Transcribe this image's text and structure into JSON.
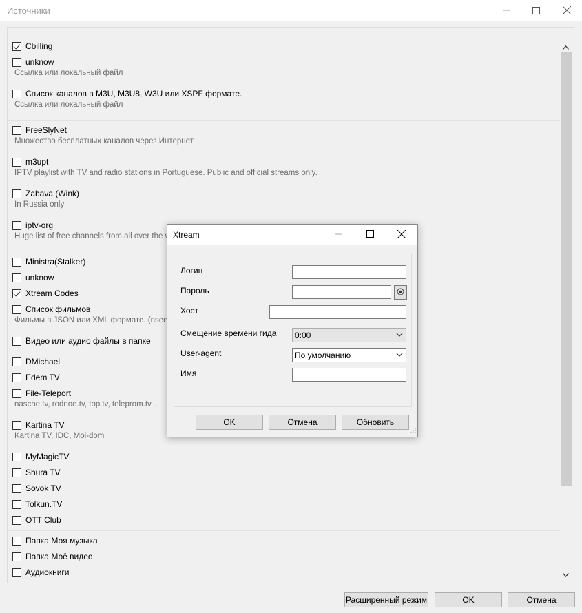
{
  "window": {
    "title": "Источники"
  },
  "sources": [
    {
      "label": "Cbilling",
      "checked": true,
      "desc": ""
    },
    {
      "label": "unknow",
      "checked": false,
      "desc": "Ссылка или локальный файл"
    },
    {
      "label": "Список каналов в M3U, M3U8, W3U или XSPF формате.",
      "checked": false,
      "desc": "Ссылка или локальный файл"
    },
    {
      "label": "FreeSlyNet",
      "checked": false,
      "desc": "Множество бесплатных каналов через Интернет"
    },
    {
      "label": "m3upt",
      "checked": false,
      "desc": "IPTV playlist with TV and radio stations in Portuguese. Public and official streams only."
    },
    {
      "label": "Zabava (Wink)",
      "checked": false,
      "desc": "In Russia only"
    },
    {
      "label": "iptv-org",
      "checked": false,
      "desc": "Huge list of free channels from all over the world"
    },
    {
      "label": "Ministra(Stalker)",
      "checked": false,
      "desc": ""
    },
    {
      "label": "unknow",
      "checked": false,
      "desc": ""
    },
    {
      "label": "Xtream Codes",
      "checked": true,
      "desc": ""
    },
    {
      "label": "Список фильмов",
      "checked": false,
      "desc": "Фильмы в JSON или XML формате. (nserv,.."
    },
    {
      "label": "Видео или аудио файлы в папке",
      "checked": false,
      "desc": ""
    },
    {
      "label": "DMichael",
      "checked": false,
      "desc": ""
    },
    {
      "label": "Edem TV",
      "checked": false,
      "desc": ""
    },
    {
      "label": "File-Teleport",
      "checked": false,
      "desc": "nasche.tv, rodnoe.tv, top.tv, teleprom.tv..."
    },
    {
      "label": "Kartina TV",
      "checked": false,
      "desc": "Kartina TV, IDC, Moi-dom"
    },
    {
      "label": "MyMagicTV",
      "checked": false,
      "desc": ""
    },
    {
      "label": "Shura TV",
      "checked": false,
      "desc": ""
    },
    {
      "label": "Sovok TV",
      "checked": false,
      "desc": ""
    },
    {
      "label": "Tolkun.TV",
      "checked": false,
      "desc": ""
    },
    {
      "label": "OTT Club",
      "checked": false,
      "desc": ""
    },
    {
      "label": "Папка Моя музыка",
      "checked": false,
      "desc": ""
    },
    {
      "label": "Папка Моё видео",
      "checked": false,
      "desc": ""
    },
    {
      "label": "Аудиокниги",
      "checked": false,
      "desc": ""
    }
  ],
  "footer": {
    "advanced_label": "Расширенный режим",
    "ok_label": "OK",
    "cancel_label": "Отмена"
  },
  "dialog": {
    "title": "Xtream",
    "login_label": "Логин",
    "login_value": "",
    "password_label": "Пароль",
    "password_value": "",
    "host_label": "Хост",
    "host_value": "",
    "time_shift_label": "Смещение времени гида",
    "time_shift_value": "0:00",
    "user_agent_label": "User-agent",
    "user_agent_value": "По умолчанию",
    "name_label": "Имя",
    "name_value": "",
    "ok_label": "OK",
    "cancel_label": "Отмена",
    "refresh_label": "Обновить"
  },
  "icons": {
    "minimize": "minimize-icon",
    "maximize": "maximize-icon",
    "close": "close-icon",
    "show_password": "eye-icon",
    "dropdown": "chevron-down-icon",
    "scroll_up": "chevron-up-icon",
    "scroll_down": "chevron-down-icon"
  }
}
